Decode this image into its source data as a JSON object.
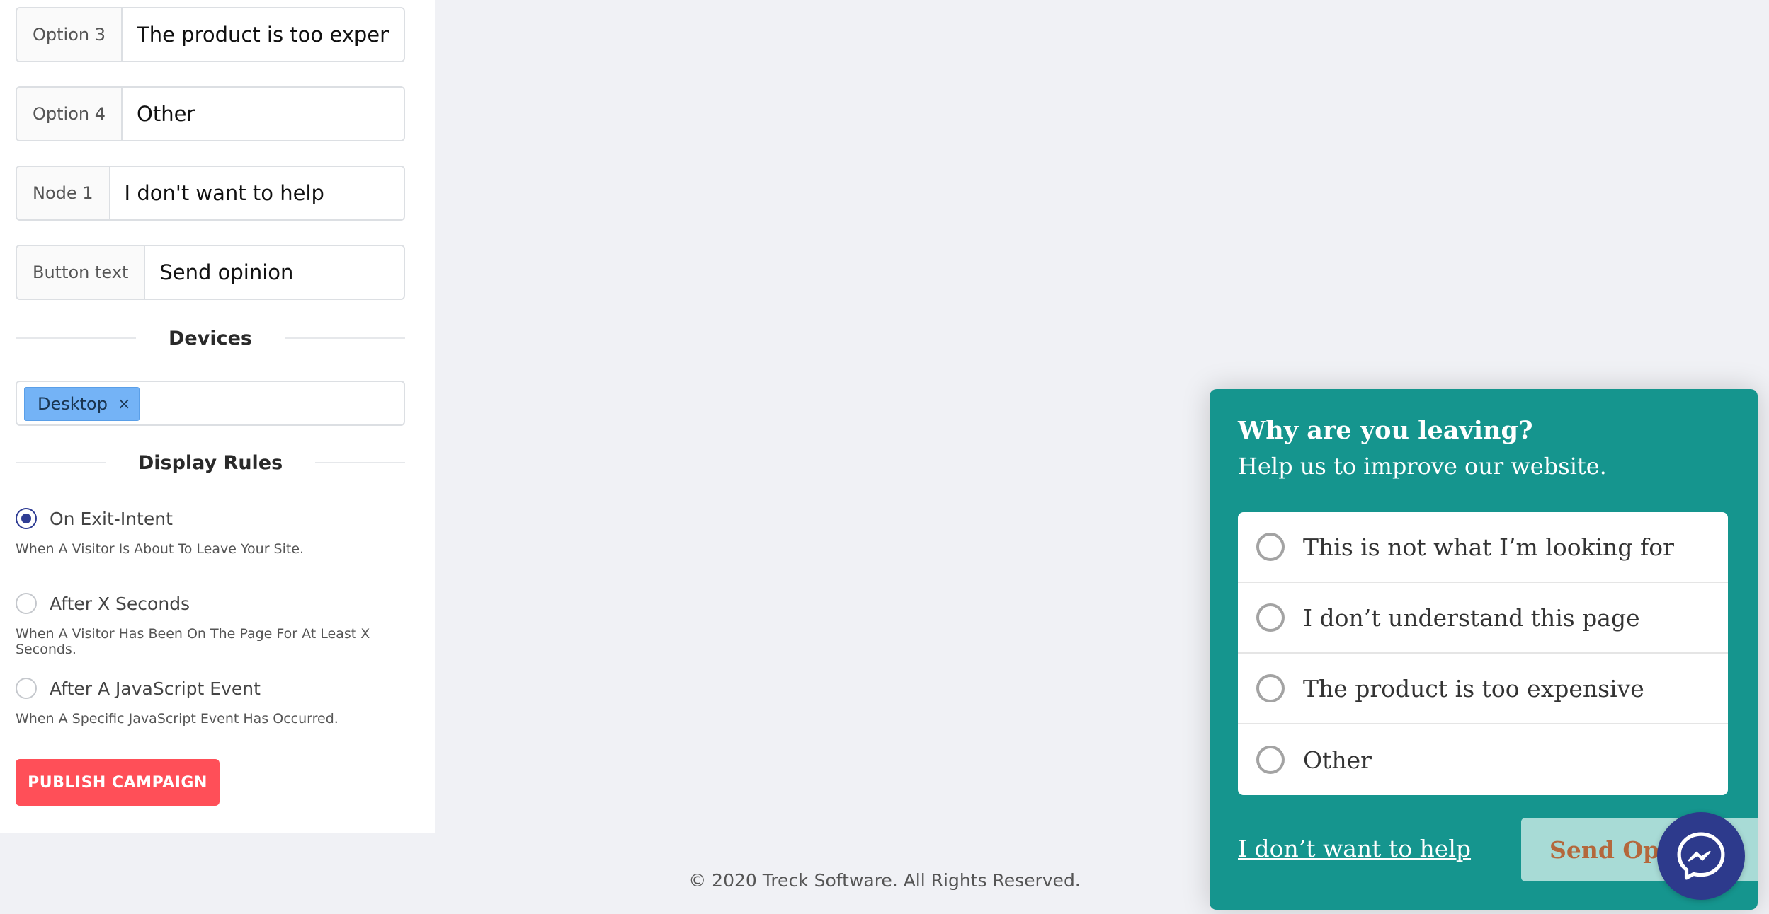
{
  "settings": {
    "fields": [
      {
        "label": "Option 3",
        "value": "The product is too expensive"
      },
      {
        "label": "Option 4",
        "value": "Other"
      },
      {
        "label": "Node 1",
        "value": "I don't want to help"
      },
      {
        "label": "Button text",
        "value": "Send opinion"
      }
    ],
    "devices": {
      "title": "Devices",
      "tags": [
        {
          "label": "Desktop",
          "remove": "×"
        }
      ]
    },
    "display_rules": {
      "title": "Display Rules",
      "options": [
        {
          "label": "On Exit-Intent",
          "description": "When A Visitor Is About To Leave Your Site.",
          "checked": true
        },
        {
          "label": "After X Seconds",
          "description": "When A Visitor Has Been On The Page For At Least X Seconds.",
          "checked": false
        },
        {
          "label": "After A JavaScript Event",
          "description": "When A Specific JavaScript Event Has Occurred.",
          "checked": false
        }
      ]
    },
    "publish_label": "PUBLISH CAMPAIGN"
  },
  "footer": {
    "text": "© 2020 Treck Software. All Rights Reserved."
  },
  "popup": {
    "title": "Why are you leaving?",
    "subtitle": "Help us to improve our website.",
    "options": [
      "This is not what I’m looking for",
      "I don’t understand this page",
      "The product is too expensive",
      "Other"
    ],
    "decline_label": "I don’t want to help",
    "submit_label": "Send Opinion"
  },
  "icons": {
    "messenger": "messenger-icon",
    "tag_close": "close-icon"
  },
  "colors": {
    "page_background": "#f0f1f5",
    "popup_teal": "#15958e",
    "publish_red": "#ff4f58",
    "radio_selected": "#2f3d94",
    "tag_blue": "#74b3f6",
    "messenger_blue": "#2d3a8c",
    "submit_text": "#b4683c"
  }
}
